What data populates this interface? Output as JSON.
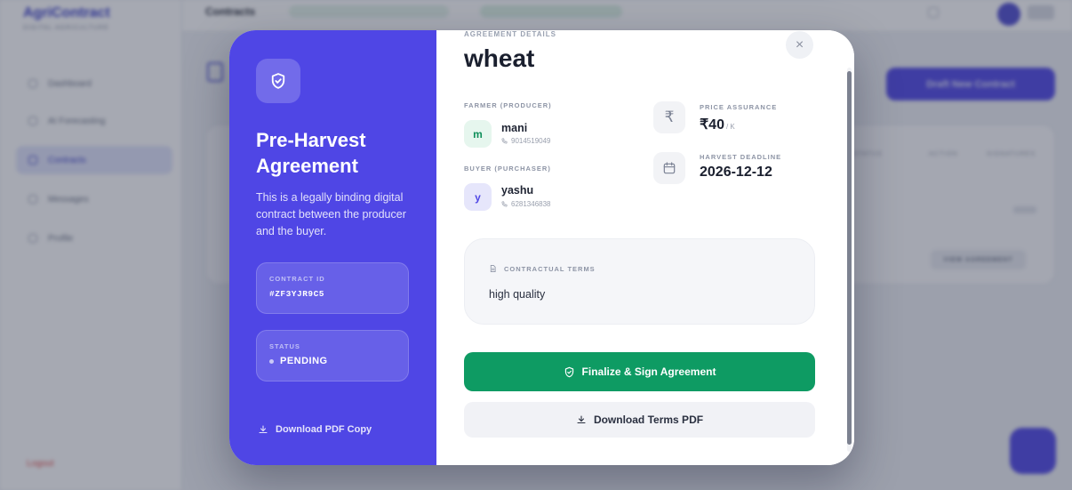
{
  "background": {
    "brand": "AgriContract",
    "brand_sub": "DIGITAL AGRICULTURE",
    "nav": [
      "Dashboard",
      "AI Forecasting",
      "Contracts",
      "Messages",
      "Profile"
    ],
    "logout": "Logout",
    "page_title": "Contracts",
    "draft_button": "Draft New Contract",
    "table_headers": [
      "STATUS",
      "ACTION",
      "SIGNATURES"
    ],
    "view_button": "VIEW AGREEMENT"
  },
  "modal": {
    "left": {
      "title": "Pre-Harvest Agreement",
      "description": "This is a legally binding digital contract between the producer and the buyer.",
      "contract_id_label": "CONTRACT ID",
      "contract_id": "#ZF3YJR9C5",
      "status_label": "STATUS",
      "status": "PENDING",
      "download_label": "Download PDF Copy"
    },
    "right": {
      "section_tag": "AGREEMENT DETAILS",
      "crop": "wheat",
      "farmer_label": "FARMER (PRODUCER)",
      "farmer_initial": "m",
      "farmer_name": "mani",
      "farmer_phone": "9014519049",
      "buyer_label": "BUYER (PURCHASER)",
      "buyer_initial": "y",
      "buyer_name": "yashu",
      "buyer_phone": "6281346838",
      "price_label": "PRICE ASSURANCE",
      "price_value": "₹40",
      "price_unit": "/ K",
      "deadline_label": "HARVEST DEADLINE",
      "deadline_value": "2026-12-12",
      "terms_label": "CONTRACTUAL TERMS",
      "terms_text": "high quality",
      "finalize_label": "Finalize & Sign Agreement",
      "download_terms_label": "Download Terms PDF",
      "close_glyph": "×"
    }
  },
  "colors": {
    "accent": "#4f46e5",
    "success": "#0e9b63"
  },
  "icons": [
    "shield-check-icon",
    "download-icon",
    "phone-icon",
    "rupee-icon",
    "calendar-icon",
    "document-icon",
    "close-icon"
  ]
}
